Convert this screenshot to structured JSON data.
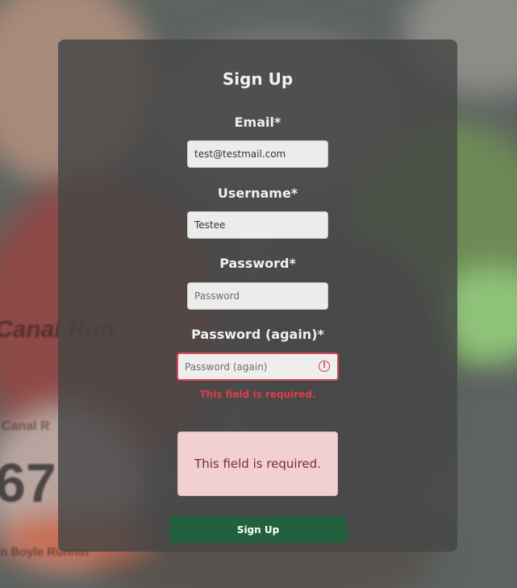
{
  "form": {
    "title": "Sign Up",
    "email": {
      "label": "Email*",
      "value": "test@testmail.com"
    },
    "username": {
      "label": "Username*",
      "value": "Testee"
    },
    "password": {
      "label": "Password*",
      "placeholder": "Password"
    },
    "password_again": {
      "label": "Password (again)*",
      "placeholder": "Password (again)",
      "error_icon": "!",
      "error": "This field is required."
    },
    "alert": {
      "message": "This field is required."
    },
    "submit_label": "Sign Up"
  },
  "background": {
    "photo_text": [
      "Canal Run",
      "Canal R",
      "67",
      "n Boyle Runnin"
    ]
  },
  "colors": {
    "error": "#e03c4c",
    "alert_bg": "#f0d0d0",
    "submit_bg": "#22603f",
    "card_bg": "#464646"
  }
}
